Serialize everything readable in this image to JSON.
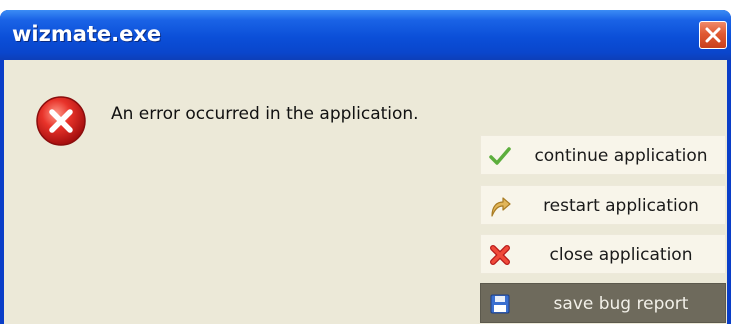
{
  "window": {
    "title": "wizmate.exe"
  },
  "dialog": {
    "message": "An error occurred in the application.",
    "icon": "error-icon"
  },
  "actions": [
    {
      "label": "continue application",
      "icon": "checkmark-icon"
    },
    {
      "label": "restart application",
      "icon": "curved-arrow-icon"
    },
    {
      "label": "close application",
      "icon": "red-x-icon"
    },
    {
      "label": "save bug report",
      "icon": "floppy-disk-icon"
    }
  ],
  "colors": {
    "titlebar": "#0b4fd8",
    "client_background": "#ece9d8",
    "close_button": "#e05a32",
    "selected_action": "#6e6a5c"
  }
}
